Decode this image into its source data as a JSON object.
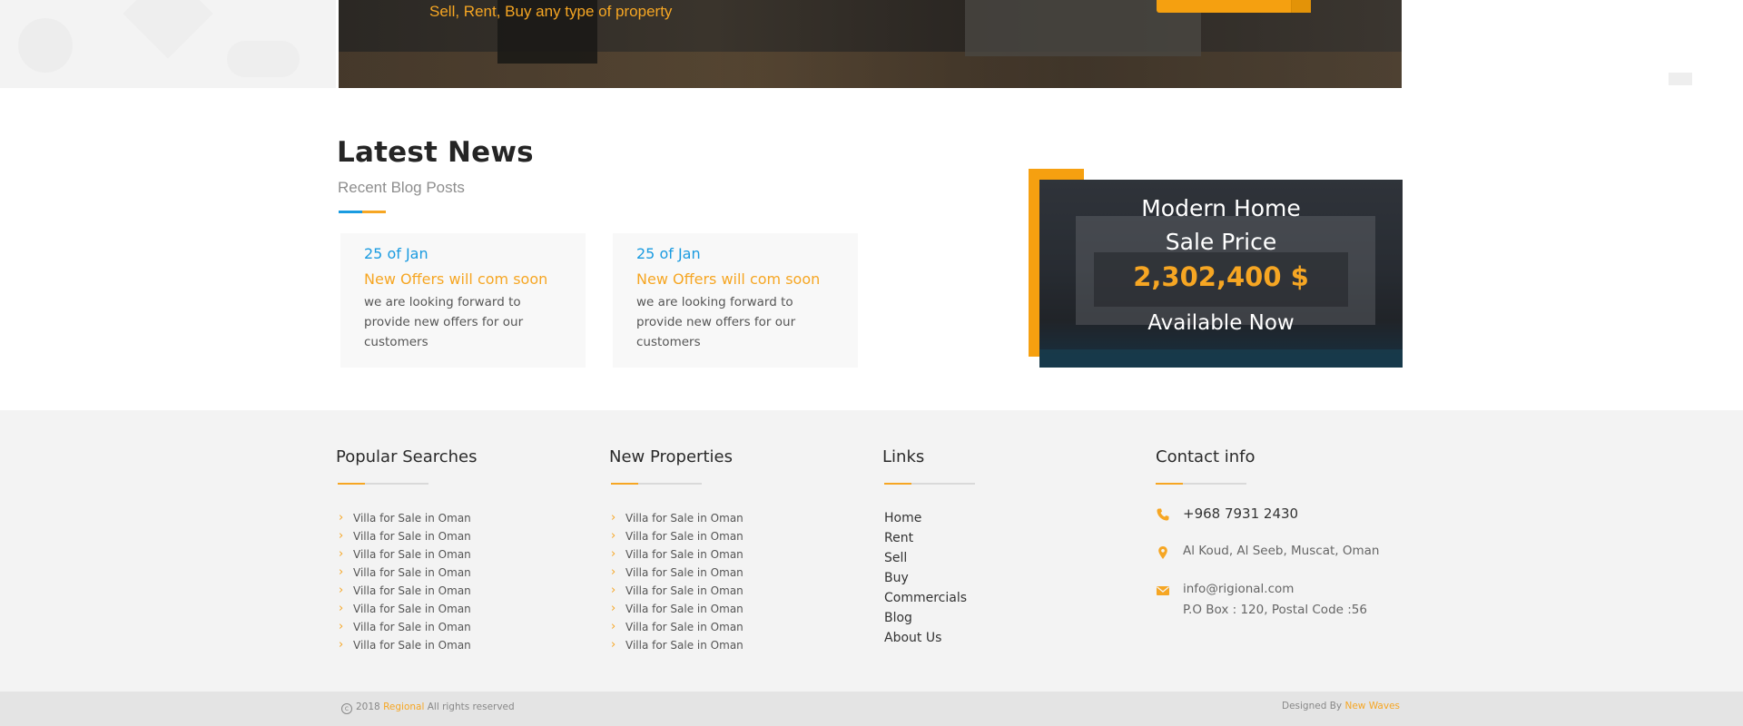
{
  "banner": {
    "subtitle": "Sell, Rent, Buy any type of property"
  },
  "news": {
    "title": "Latest News",
    "subtitle": "Recent Blog Posts",
    "posts": [
      {
        "date": "25 of Jan",
        "title": "New Offers will com soon",
        "text": "we are looking forward to provide new offers for our customers"
      },
      {
        "date": "25 of Jan",
        "title": "New Offers will com soon",
        "text": "we are looking forward to provide new offers for our customers"
      }
    ]
  },
  "promo": {
    "line1": "Modern Home",
    "line2": "Sale Price",
    "price": "2,302,400 $",
    "availability": "Available Now"
  },
  "footer": {
    "popular": {
      "title": "Popular Searches",
      "items": [
        "Villa for Sale in Oman",
        "Villa for Sale in Oman",
        "Villa for Sale in Oman",
        "Villa for Sale in Oman",
        "Villa for Sale in Oman",
        "Villa for Sale in Oman",
        "Villa for Sale in Oman",
        "Villa for Sale in Oman"
      ]
    },
    "new_properties": {
      "title": "New Properties",
      "items": [
        "Villa for Sale in Oman",
        "Villa for Sale in Oman",
        "Villa for Sale in Oman",
        "Villa for Sale in Oman",
        "Villa for Sale in Oman",
        "Villa for Sale in Oman",
        "Villa for Sale in Oman",
        "Villa for Sale in Oman"
      ]
    },
    "links": {
      "title": "Links",
      "items": [
        "Home",
        "Rent",
        "Sell",
        "Buy",
        "Commercials",
        "Blog",
        "About Us"
      ]
    },
    "contact": {
      "title": "Contact info",
      "phone": "+968 7931 2430",
      "address": "Al Koud, Al Seeb, Muscat, Oman",
      "email": "info@rigional.com",
      "po_box": "P.O Box : 120, Postal Code :56"
    }
  },
  "bottom_bar": {
    "year": "2018",
    "brand": "Regional",
    "rights": "All rights reserved",
    "designed_by": "Designed By",
    "designer": "New Waves"
  },
  "colors": {
    "accent": "#f6a623",
    "blue": "#1a9be0"
  },
  "icons": {
    "chevron": "chevron-right-icon",
    "phone": "phone-icon",
    "location": "map-marker-icon",
    "email": "envelope-icon",
    "copyright": "copyright-icon"
  }
}
